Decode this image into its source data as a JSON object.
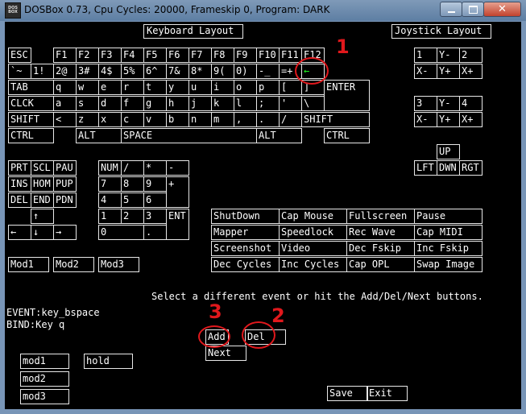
{
  "window": {
    "title": "DOSBox 0.73, Cpu Cycles:    20000, Frameskip  0, Program:      DARK",
    "icon_label": "DOS BOX",
    "minimize_icon": "minimize-icon",
    "maximize_icon": "maximize-icon",
    "close_icon": "close-icon"
  },
  "mapper": {
    "headers": {
      "keyboard": "Keyboard Layout",
      "joystick": "Joystick Layout"
    },
    "keys": {
      "esc": "ESC",
      "f1": "F1",
      "f2": "F2",
      "f3": "F3",
      "f4": "F4",
      "f5": "F5",
      "f6": "F6",
      "f7": "F7",
      "f8": "F8",
      "f9": "F9",
      "f10": "F10",
      "f11": "F11",
      "f12": "F12",
      "grave": "`~",
      "n1": "1!",
      "n2": "2@",
      "n3": "3#",
      "n4": "4$",
      "n5": "5%",
      "n6": "6^",
      "n7": "7&",
      "n8": "8*",
      "n9": "9(",
      "n0": "0)",
      "minus": "-_",
      "equals": "=+",
      "backspace": "←",
      "tab": "TAB",
      "q": "q",
      "w": "w",
      "e": "e",
      "r": "r",
      "t": "t",
      "y": "y",
      "u": "u",
      "i": "i",
      "o": "o",
      "p": "p",
      "lbracket": "[",
      "rbracket": "]",
      "enter": "ENTER",
      "clck": "CLCK",
      "a": "a",
      "s": "s",
      "d": "d",
      "f": "f",
      "g": "g",
      "h": "h",
      "j": "j",
      "k": "k",
      "l": "l",
      "semicolon": ";",
      "quote": "'",
      "backslash": "\\",
      "lshift": "SHIFT",
      "lt": "<",
      "z": "z",
      "x": "x",
      "c": "c",
      "v": "v",
      "b": "b",
      "n": "n",
      "m": "m",
      "comma": ",",
      "period": ".",
      "slash": "/",
      "rshift": "SHIFT",
      "lctrl": "CTRL",
      "lalt": "ALT",
      "space": "SPACE",
      "ralt": "ALT",
      "rctrl": "CTRL",
      "prt": "PRT",
      "scl": "SCL",
      "pau": "PAU",
      "ins": "INS",
      "hom": "HOM",
      "pup": "PUP",
      "del": "DEL",
      "end": "END",
      "pdn": "PDN",
      "up": "↑",
      "left": "←",
      "down": "↓",
      "right": "→",
      "num": "NUM",
      "kp_div": "/",
      "kp_mul": "*",
      "kp_minus": "-",
      "kp7": "7",
      "kp8": "8",
      "kp9": "9",
      "kp_plus": "+",
      "kp4": "4",
      "kp5": "5",
      "kp6": "6",
      "kp1": "1",
      "kp2": "2",
      "kp3": "3",
      "kp_enter": "ENT",
      "kp0": "0",
      "kp_dot": ".",
      "mod1": "Mod1",
      "mod2": "Mod2",
      "mod3": "Mod3"
    },
    "joystick": {
      "j1": "1",
      "j1_ym": "Y-",
      "j2": "2",
      "j1_xm": "X-",
      "j1_yp": "Y+",
      "j1_xp": "X+",
      "j3": "3",
      "j2_ym": "Y-",
      "j4": "4",
      "j2_xm": "X-",
      "j2_yp": "Y+",
      "j2_xp": "X+",
      "hat_up": "UP",
      "hat_left": "LFT",
      "hat_down": "DWN",
      "hat_right": "RGT"
    },
    "events": {
      "shutdown": "ShutDown",
      "capmouse": "Cap Mouse",
      "fullscreen": "Fullscreen",
      "pause": "Pause",
      "mapper": "Mapper",
      "speedlock": "Speedlock",
      "recwave": "Rec Wave",
      "capmidi": "Cap MIDI",
      "screenshot": "Screenshot",
      "video": "Video",
      "decfskip": "Dec Fskip",
      "incfskip": "Inc Fskip",
      "deccycles": "Dec Cycles",
      "inccycles": "Inc Cycles",
      "capopl": "Cap OPL",
      "swapimage": "Swap Image"
    },
    "message": "Select a different event or hit the Add/Del/Next buttons.",
    "event_line": "EVENT:key_bspace",
    "bind_line": "BIND:Key q",
    "buttons": {
      "add": "Add",
      "del": "Del",
      "next": "Next",
      "save": "Save",
      "exit": "Exit"
    },
    "modifiers": {
      "mod1": "mod1",
      "mod2": "mod2",
      "mod3": "mod3",
      "hold": "hold"
    },
    "annotations": {
      "one": "1",
      "two": "2",
      "three": "3"
    }
  },
  "colors": {
    "selected_key": "#22ff22",
    "annotation": "#e0181c",
    "screen": "#000000",
    "frame": "#7895b7"
  }
}
